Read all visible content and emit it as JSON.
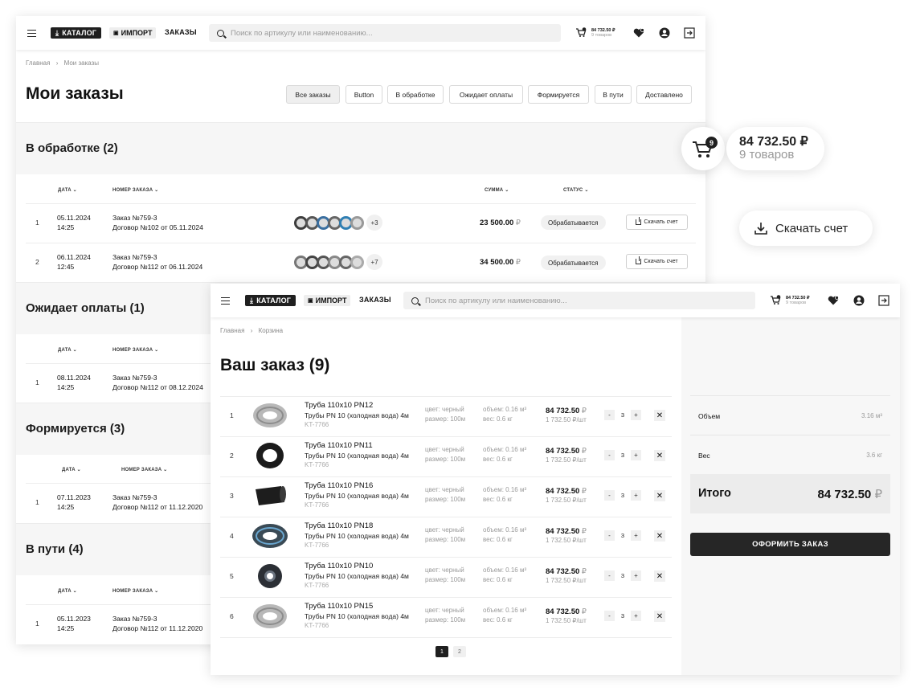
{
  "header": {
    "catalog": "КАТАЛОГ",
    "import": "ИМПОРТ",
    "orders": "ЗАКАЗЫ",
    "search_placeholder": "Поиск по артикулу или наименованию...",
    "cart_count": "9",
    "cart_sum": "84 732.50 ₽",
    "cart_items": "9 товаров"
  },
  "orders_page": {
    "breadcrumb": [
      "Главная",
      "Мои заказы"
    ],
    "title": "Мои заказы",
    "filters": [
      "Все заказы",
      "Button",
      "В обработке",
      "Ожидает оплаты",
      "Формируется",
      "В пути",
      "Доставлено"
    ],
    "columns": {
      "date": "ДАТА",
      "number": "НОМЕР ЗАКАЗА",
      "sum": "СУММА",
      "status": "СТАТУС"
    },
    "sections": [
      {
        "title": "В обработке (2)",
        "rows": [
          {
            "n": "1",
            "date": "05.11.2024",
            "time": "14:25",
            "number": "Заказ №759-3",
            "contract": "Договор №102 от 05.11.2024",
            "more": "+3",
            "sum": "23 500.00",
            "currency": "₽",
            "status": "Обрабатывается",
            "download": "Скачать счет"
          },
          {
            "n": "2",
            "date": "06.11.2024",
            "time": "12:45",
            "number": "Заказ №759-3",
            "contract": "Договор №112 от 06.11.2024",
            "more": "+7",
            "sum": "34 500.00",
            "currency": "₽",
            "status": "Обрабатывается",
            "download": "Скачать счет"
          }
        ]
      },
      {
        "title": "Ожидает оплаты (1)",
        "rows": [
          {
            "n": "1",
            "date": "08.11.2024",
            "time": "14:25",
            "number": "Заказ №759-3",
            "contract": "Договор №112 от 08.12.2024"
          }
        ]
      },
      {
        "title": "Формируется (3)",
        "rows": [
          {
            "n": "1",
            "date": "07.11.2023",
            "time": "14:25",
            "number": "Заказ №759-3",
            "contract": "Договор №112 от 11.12.2020"
          }
        ]
      },
      {
        "title": "В пути (4)",
        "rows": [
          {
            "n": "1",
            "date": "05.11.2023",
            "time": "14:25",
            "number": "Заказ №759-3",
            "contract": "Договор №112 от 11.12.2020"
          }
        ]
      }
    ]
  },
  "floating": {
    "cart_count": "9",
    "cart_sum": "84 732.50 ₽",
    "cart_items": "9 товаров",
    "download": "Скачать счет"
  },
  "cart_page": {
    "breadcrumb": [
      "Главная",
      "Корзина"
    ],
    "title": "Ваш заказ (9)",
    "items": [
      {
        "n": "1",
        "name": "Труба 110х10 PN12",
        "sub": "Трубы PN 10 (холодная вода) 4м",
        "kt": "KT-7766",
        "color": "цвет: черный",
        "size": "размер: 100м",
        "volume": "объем: 0.16 м³",
        "weight": "вес: 0.6 кг",
        "price": "84 732.50",
        "currency": "₽",
        "unit": "1 732.50 ₽/шт",
        "qty": "3",
        "thumb": "coil-grey"
      },
      {
        "n": "2",
        "name": "Труба 110х10 PN11",
        "sub": "Трубы PN 10 (холодная вода) 4м",
        "kt": "KT-7766",
        "color": "цвет: черный",
        "size": "размер: 100м",
        "volume": "объем: 0.16 м³",
        "weight": "вес: 0.6 кг",
        "price": "84 732.50",
        "currency": "₽",
        "unit": "1 732.50 ₽/шт",
        "qty": "3",
        "thumb": "coil-black"
      },
      {
        "n": "3",
        "name": "Труба 110х10 PN16",
        "sub": "Трубы PN 10 (холодная вода) 4м",
        "kt": "KT-7766",
        "color": "цвет: черный",
        "size": "размер: 100м",
        "volume": "объем: 0.16 м³",
        "weight": "вес: 0.6 кг",
        "price": "84 732.50",
        "currency": "₽",
        "unit": "1 732.50 ₽/шт",
        "qty": "3",
        "thumb": "pipe-black"
      },
      {
        "n": "4",
        "name": "Труба 110х10 PN18",
        "sub": "Трубы PN 10 (холодная вода) 4м",
        "kt": "KT-7766",
        "color": "цвет: черный",
        "size": "размер: 100м",
        "volume": "объем: 0.16 м³",
        "weight": "вес: 0.6 кг",
        "price": "84 732.50",
        "currency": "₽",
        "unit": "1 732.50 ₽/шт",
        "qty": "3",
        "thumb": "coil-blue"
      },
      {
        "n": "5",
        "name": "Труба 110х10 PN10",
        "sub": "Трубы PN 10 (холодная вода) 4м",
        "kt": "KT-7766",
        "color": "цвет: черный",
        "size": "размер: 100м",
        "volume": "объем: 0.16 м³",
        "weight": "вес: 0.6 кг",
        "price": "84 732.50",
        "currency": "₽",
        "unit": "1 732.50 ₽/шт",
        "qty": "3",
        "thumb": "pipe-dark"
      },
      {
        "n": "6",
        "name": "Труба 110х10 PN15",
        "sub": "Трубы PN 10 (холодная вода) 4м",
        "kt": "KT-7766",
        "color": "цвет: черный",
        "size": "размер: 100м",
        "volume": "объем: 0.16 м³",
        "weight": "вес: 0.6 кг",
        "price": "84 732.50",
        "currency": "₽",
        "unit": "1 732.50 ₽/шт",
        "qty": "3",
        "thumb": "coil-grey"
      }
    ],
    "pagination": [
      "1",
      "2"
    ],
    "summary": {
      "volume_label": "Объем",
      "volume_value": "3.16 м³",
      "weight_label": "Вес",
      "weight_value": "3.6 кг",
      "total_label": "Итого",
      "total_value": "84 732.50",
      "currency": "₽",
      "checkout": "ОФОРМИТЬ ЗАКАЗ"
    }
  }
}
